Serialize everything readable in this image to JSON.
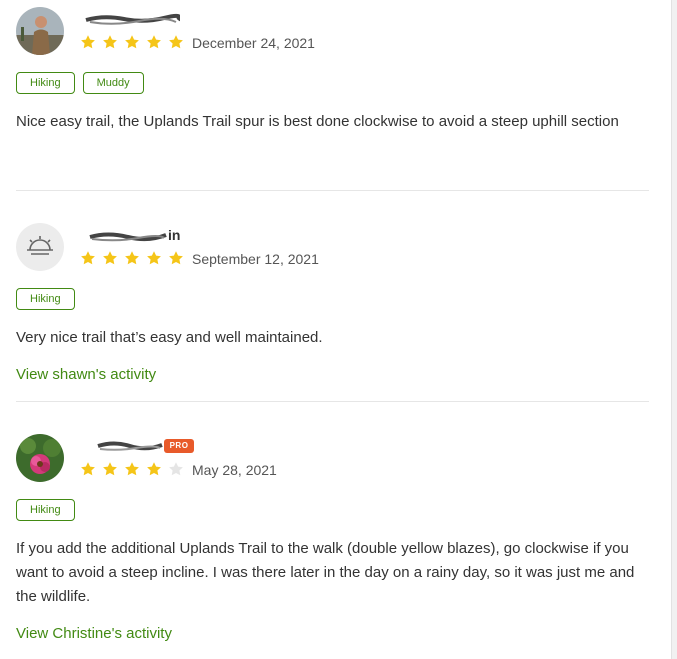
{
  "reviews": [
    {
      "date": "December 24, 2021",
      "rating": 5,
      "tags": [
        "Hiking",
        "Muddy"
      ],
      "text": "Nice easy trail, the Uplands Trail spur is best done clockwise to avoid a steep uphill section",
      "activity_link": ""
    },
    {
      "name_suffix": "in",
      "date": "September 12, 2021",
      "rating": 5,
      "tags": [
        "Hiking"
      ],
      "text": "Very nice trail that’s easy and well maintained.",
      "activity_link": "View shawn's activity"
    },
    {
      "pro_badge": "PRO",
      "date": "May 28, 2021",
      "rating": 4,
      "tags": [
        "Hiking"
      ],
      "text": "If you add the additional Uplands Trail to the walk (double yellow blazes), go clockwise if you want to avoid a steep incline.  I was there later in the day on a rainy day, so it was just me and the wildlife.",
      "activity_link": "View Christine's activity"
    }
  ],
  "colors": {
    "star_filled": "#f5c518",
    "star_empty": "#e5e5e5",
    "accent_green": "#428a13",
    "pro_badge": "#e85a2a"
  },
  "icons": {
    "star": "star-icon",
    "sunrise": "sunrise-icon"
  }
}
